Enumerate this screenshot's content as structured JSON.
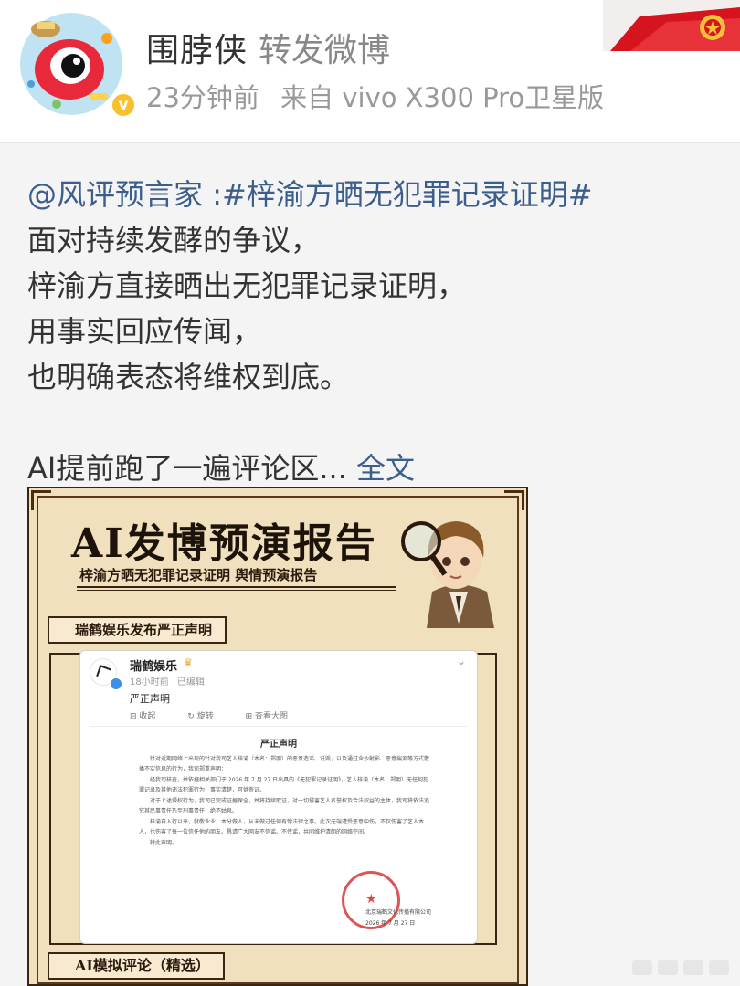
{
  "header": {
    "username": "围脖侠",
    "post_type": "转发微博",
    "time": "23分钟前",
    "source": "来自 vivo X300 Pro卫星版"
  },
  "post": {
    "mention": "@风评预言家",
    "topic": " :#梓渝方晒无犯罪记录证明#",
    "lines": [
      "面对持续发酵的争议，",
      "梓渝方直接晒出无犯罪记录证明，",
      "用事实回应传闻，",
      "也明确表态将维权到底。"
    ],
    "teaser": "AI提前跑了一遍评论区... ",
    "full_text_link": "全文"
  },
  "image": {
    "title": "AI发博预演报告",
    "subtitle": "梓渝方晒无犯罪记录证明  舆情预演报告",
    "section1": "瑞鹤娱乐发布严正声明",
    "section2": "AI模拟评论（精选）",
    "embedded_post": {
      "name": "瑞鹤娱乐",
      "time": "18小时前",
      "edited": "已编辑",
      "text": "严正声明",
      "actions": [
        "收起",
        "旋转",
        "查看大图"
      ],
      "doc_title": "严正声明",
      "doc_paragraphs": [
        "针对近期网络上出现的针对我司艺人梓渝（本名：郑朋）的恶意造谣、诋毁，以及通过含沙射影、恶意揣测等方式散播不实信息的行为，我司郑重声明：",
        "经我司核查，并依据相关部门于 2026 年 7 月 27 日出具的《无犯罪记录证明》，艺人梓渝（本名：郑朋）无任何犯罪记录及其他违法犯罪行为，事实清楚，可供查证。",
        "对于上述侵权行为，我司已完成证据保全，并将持续取证，对一切侵害艺人名誉权及合法权益的主体，我司将依法追究其民事责任乃至刑事责任，绝不姑息。",
        "梓渝自入行以来，就敬业业，本分做人，从未做过任何有悖法律之事。此次无端遭受恶意中伤，不仅伤害了艺人本人，也伤害了每一位信任他的朋友。恳请广大网友不信谣、不传谣，共同维护清朗的网络空间。",
        "特此声明。"
      ],
      "doc_company": "北京瑞鹤文化传播有限公司",
      "doc_date": "2026 年 7 月 27 日"
    }
  }
}
